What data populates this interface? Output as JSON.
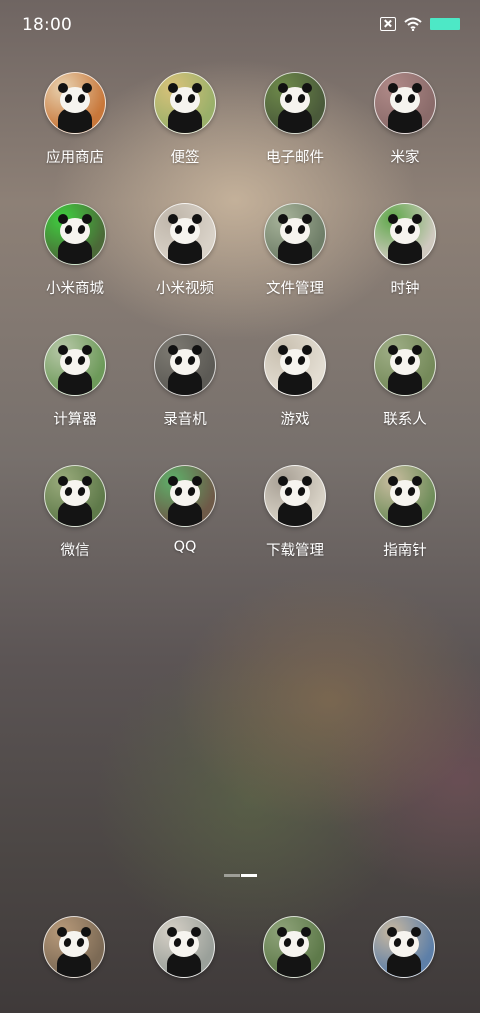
{
  "status_bar": {
    "time": "18:00",
    "icons": [
      "sim-x-icon",
      "wifi-icon",
      "battery-icon"
    ],
    "battery_color": "#4de8c6"
  },
  "apps": [
    {
      "label": "应用商店",
      "icon": "panda-photo-icon",
      "bg": "#c8773a",
      "accent": "#e8d2b0"
    },
    {
      "label": "便签",
      "icon": "panda-photo-icon",
      "bg": "#9ab06a",
      "accent": "#d9c27a"
    },
    {
      "label": "电子邮件",
      "icon": "panda-photo-icon",
      "bg": "#4a5a3a",
      "accent": "#6e8a4a"
    },
    {
      "label": "米家",
      "icon": "panda-photo-icon",
      "bg": "#8a6b6a",
      "accent": "#b08a88"
    },
    {
      "label": "小米商城",
      "icon": "panda-photo-icon",
      "bg": "#4b6a38",
      "accent": "#3fcf3f"
    },
    {
      "label": "小米视频",
      "icon": "panda-photo-icon",
      "bg": "#d9d2c8",
      "accent": "#bfb6aa"
    },
    {
      "label": "文件管理",
      "icon": "panda-photo-icon",
      "bg": "#6f7e68",
      "accent": "#a7b39a"
    },
    {
      "label": "时钟",
      "icon": "panda-photo-icon",
      "bg": "#cfc9bf",
      "accent": "#5fa84a"
    },
    {
      "label": "计算器",
      "icon": "panda-photo-icon",
      "bg": "#6d9a5a",
      "accent": "#b8c8a8"
    },
    {
      "label": "录音机",
      "icon": "panda-photo-icon",
      "bg": "#5c5a55",
      "accent": "#7d7a72"
    },
    {
      "label": "游戏",
      "icon": "panda-photo-icon",
      "bg": "#e3ddd2",
      "accent": "#c9c0b0"
    },
    {
      "label": "联系人",
      "icon": "panda-photo-icon",
      "bg": "#758a5a",
      "accent": "#9fae86"
    },
    {
      "label": "微信",
      "icon": "panda-photo-icon",
      "bg": "#5f7a4a",
      "accent": "#9aab7c"
    },
    {
      "label": "QQ",
      "icon": "panda-photo-icon",
      "bg": "#6e5a48",
      "accent": "#5fb06a"
    },
    {
      "label": "下载管理",
      "icon": "panda-photo-icon",
      "bg": "#d8d2c6",
      "accent": "#a8a095"
    },
    {
      "label": "指南针",
      "icon": "panda-photo-icon",
      "bg": "#6f8d5a",
      "accent": "#c9bda0"
    }
  ],
  "page_indicator": {
    "pages": 2,
    "current": 2
  },
  "dock": [
    {
      "icon": "panda-photo-icon",
      "bg": "#7c6a55",
      "accent": "#b89a7a"
    },
    {
      "icon": "panda-photo-icon",
      "bg": "#9aa09a",
      "accent": "#d6d0c6"
    },
    {
      "icon": "panda-photo-icon",
      "bg": "#5e7a4a",
      "accent": "#8fa37a"
    },
    {
      "icon": "panda-photo-icon",
      "bg": "#5d7fa8",
      "accent": "#c8b8a0"
    }
  ]
}
